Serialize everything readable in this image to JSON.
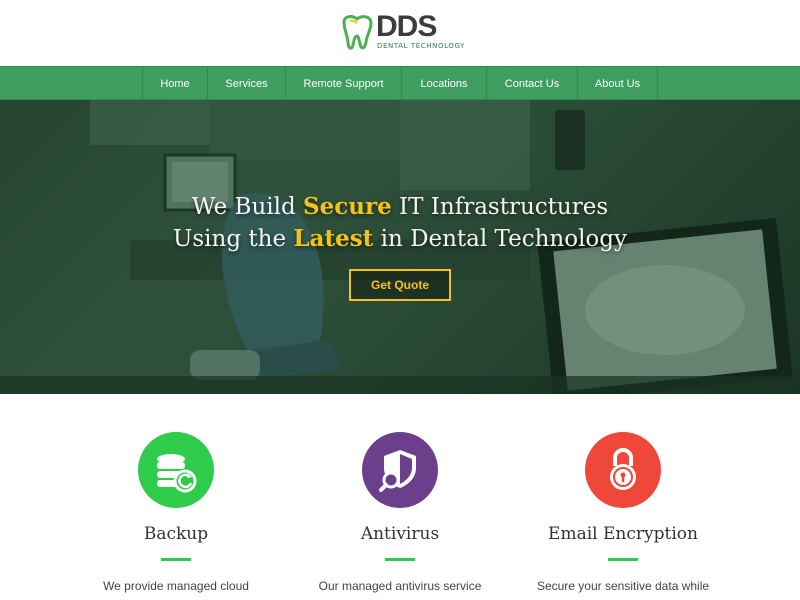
{
  "brand": {
    "logo_text": "DDS",
    "logo_subtext": "DENTAL TECHNOLOGY",
    "colors": {
      "primary_green": "#3e9e5f",
      "accent_yellow": "#f3c31a"
    }
  },
  "nav": {
    "items": [
      {
        "label": "Home"
      },
      {
        "label": "Services"
      },
      {
        "label": "Remote Support"
      },
      {
        "label": "Locations"
      },
      {
        "label": "Contact Us"
      },
      {
        "label": "About Us"
      }
    ]
  },
  "hero": {
    "line1_pre": "We Build ",
    "line1_highlight": "Secure",
    "line1_post": " IT Infrastructures",
    "line2_pre": "Using the ",
    "line2_highlight": "Latest",
    "line2_post": " in Dental Technology",
    "cta_label": "Get Quote"
  },
  "features": [
    {
      "title": "Backup",
      "description": "We provide managed cloud",
      "icon": "database-sync-icon",
      "color": "#2ecc4a"
    },
    {
      "title": "Antivirus",
      "description": "Our managed antivirus service",
      "icon": "shield-search-icon",
      "color": "#6b3f8c"
    },
    {
      "title": "Email Encryption",
      "description": "Secure your sensitive data while",
      "icon": "padlock-icon",
      "color": "#f0473b"
    }
  ]
}
